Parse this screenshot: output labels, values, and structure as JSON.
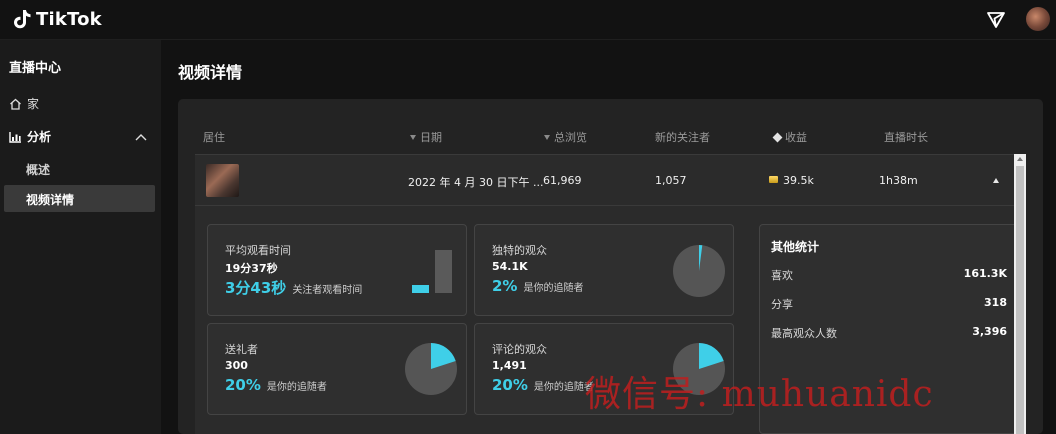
{
  "app": {
    "brand": "TikTok"
  },
  "sidebar": {
    "title": "直播中心",
    "home": "家",
    "analysis": "分析",
    "sub_overview": "概述",
    "sub_video_details": "视频详情"
  },
  "page": {
    "title": "视频详情"
  },
  "table": {
    "headers": {
      "location": "居住",
      "date": "日期",
      "views": "总浏览",
      "new_followers": "新的关注者",
      "revenue": "收益",
      "duration": "直播时长"
    },
    "row": {
      "date": "2022 年 4 月 30 日下午 ...",
      "views": "61,969",
      "new_followers": "1,057",
      "revenue": "39.5k",
      "duration": "1h38m"
    }
  },
  "cards": {
    "avg_watch": {
      "label": "平均观看时间",
      "value": "19分37秒",
      "big": "3分43秒",
      "desc": "关注者观看时间"
    },
    "unique_viewers": {
      "label": "独特的观众",
      "value": "54.1K",
      "big": "2%",
      "desc": "是你的追随者"
    },
    "gifters": {
      "label": "送礼者",
      "value": "300",
      "big": "20%",
      "desc": "是你的追随者"
    },
    "commenters": {
      "label": "评论的观众",
      "value": "1,491",
      "big": "20%",
      "desc": "是你的追随者"
    }
  },
  "other_stats": {
    "title": "其他统计",
    "likes_label": "喜欢",
    "likes": "161.3K",
    "shares_label": "分享",
    "shares": "318",
    "peak_label": "最高观众人数",
    "peak": "3,396"
  },
  "watermark": "微信号: muhuanidc",
  "colors": {
    "accent": "#3fcfe8",
    "background": "#121212",
    "panel": "#232323"
  }
}
